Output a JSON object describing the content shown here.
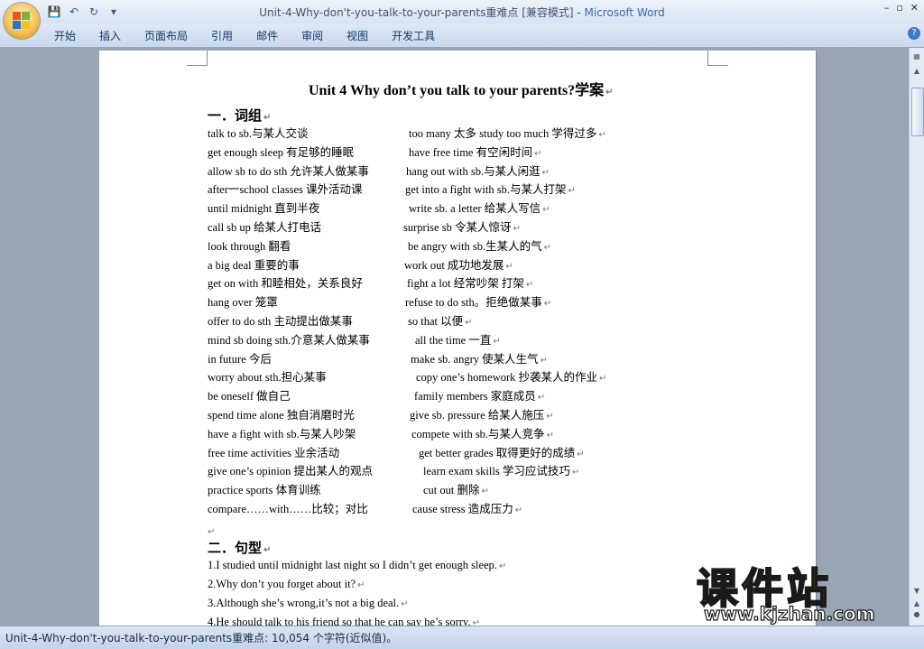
{
  "window": {
    "title": "Unit-4-Why-don't-you-talk-to-your-parents重难点 [兼容模式] - ",
    "app_name": "Microsoft Word"
  },
  "ribbon": {
    "tabs": [
      "开始",
      "插入",
      "页面布局",
      "引用",
      "邮件",
      "审阅",
      "视图",
      "开发工具"
    ]
  },
  "document": {
    "title": "Unit 4 Why don’t you talk to your parents?学案",
    "section1": "一．词组",
    "phrases": [
      [
        "talk to sb.与某人交谈",
        "too many 太多    study too much 学得过多"
      ],
      [
        "get enough sleep 有足够的睡眠",
        "have free time 有空闲时间"
      ],
      [
        "allow sb to do sth 允许某人做某事",
        "hang out with sb.与某人闲逛"
      ],
      [
        "after一school classes 课外活动课",
        "get into a fight with sb.与某人打架"
      ],
      [
        "until midnight 直到半夜",
        "write sb. a letter 给某人写信"
      ],
      [
        "call sb up 给某人打电话",
        "surprise sb 令某人惊讶"
      ],
      [
        "look through 翻看",
        "be angry with sb.生某人的气"
      ],
      [
        "a big deal 重要的事",
        "work out 成功地发展"
      ],
      [
        "get on with 和睦相处，关系良好",
        "fight a lot  经常吵架 打架"
      ],
      [
        "hang over 笼罩",
        "refuse to do sth。拒绝做某事"
      ],
      [
        "offer to do sth 主动提出做某事",
        "so that   以便"
      ],
      [
        "mind sb doing sth.介意某人做某事",
        "all the time 一直"
      ],
      [
        "in future 今后",
        "make sb. angry 使某人生气"
      ],
      [
        "worry about sth.担心某事",
        "copy one’s homework 抄袭某人的作业"
      ],
      [
        "be oneself 做自己",
        "family members 家庭成员"
      ],
      [
        "spend time alone 独自消磨时光",
        "give sb. pressure 给某人施压"
      ],
      [
        "have a fight with sb.与某人吵架",
        "compete with sb.与某人竞争"
      ],
      [
        "free time activities 业余活动",
        "get better grades 取得更好的成绩"
      ],
      [
        "give one’s opinion 提出某人的观点",
        "learn exam skills 学习应试技巧"
      ],
      [
        "practice sports 体育训练",
        "cut out  删除"
      ],
      [
        "compare……with……比较；对比",
        "cause stress  造成压力"
      ]
    ],
    "section2": "二．句型",
    "sentences": [
      "1.I studied until midnight last night so I didn’t get enough sleep.",
      "2.Why don’t you forget about it?",
      "3.Although she’s wrong,it’s not a big deal.",
      "4.He should talk to his friend so that he can say he’s sorry."
    ],
    "paragraph_mark": "↵"
  },
  "status_bar": {
    "text": "Unit-4-Why-don't-you-talk-to-your-parents重难点: 10,054 个字符(近似值)。"
  },
  "watermark": {
    "brand": "课件站",
    "url": "www.kjzhan.com"
  },
  "window_controls": [
    "–",
    "▫",
    "✕"
  ],
  "help_label": "?"
}
